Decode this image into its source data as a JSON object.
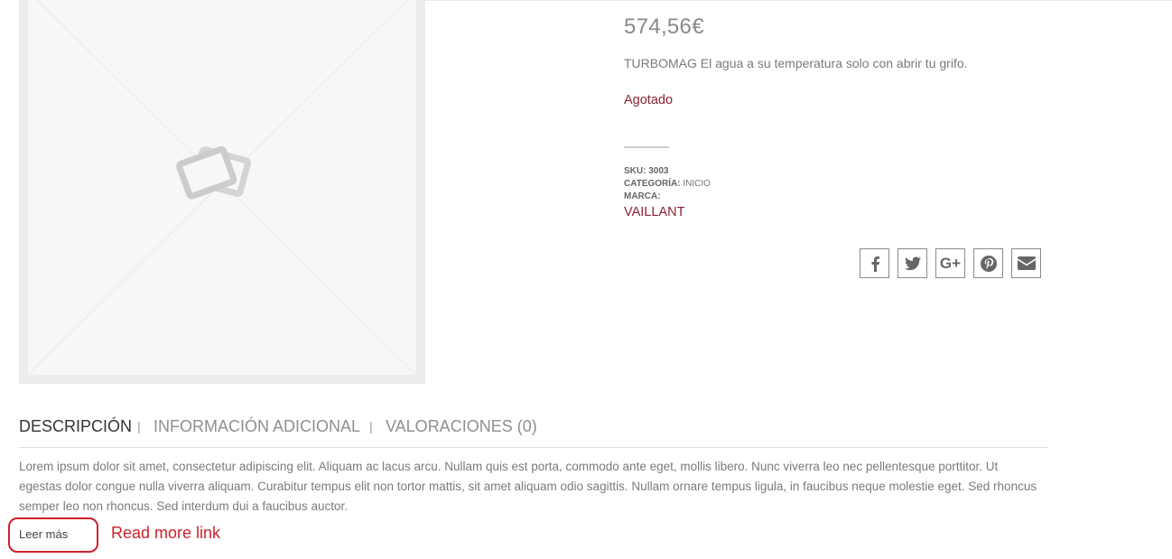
{
  "product": {
    "price": "574,56€",
    "short_description": "TURBOMAG El agua a su temperatura solo con abrir tu grifo.",
    "stock_status": "Agotado",
    "meta": {
      "sku_label": "SKU:",
      "sku_value": "3003",
      "category_label": "CATEGORÍA:",
      "category_value": "INICIO",
      "brand_label": "MARCA:",
      "brand_value": "VAILLANT"
    },
    "image_icon": "image-placeholder-icon"
  },
  "share": {
    "buttons": [
      {
        "name": "facebook",
        "icon": "facebook-icon"
      },
      {
        "name": "twitter",
        "icon": "twitter-icon"
      },
      {
        "name": "google-plus",
        "icon": "google-plus-icon",
        "text": "G+"
      },
      {
        "name": "pinterest",
        "icon": "pinterest-icon"
      },
      {
        "name": "email",
        "icon": "envelope-icon"
      }
    ]
  },
  "tabs": {
    "description": "DESCRIPCIÓN",
    "additional_info": "INFORMACIÓN ADICIONAL",
    "reviews": "VALORACIONES (0)",
    "separator": "|",
    "active": "description"
  },
  "description": {
    "text": "Lorem ipsum dolor sit amet, consectetur adipiscing elit. Aliquam ac lacus arcu. Nullam quis est porta, commodo ante eget, mollis libero. Nunc viverra leo nec pellentesque porttitor. Ut egestas dolor congue nulla viverra aliquam. Curabitur tempus elit non tortor mattis, sit amet aliquam odio sagittis. Nullam ornare tempus ligula, in faucibus neque molestie eget. Sed rhoncus semper leo non rhoncus. Sed interdum dui a faucibus auctor.",
    "read_more": "Leer más"
  },
  "annotation": {
    "label": "Read more link",
    "color": "#d0202a"
  },
  "colors": {
    "accent": "#8b2331",
    "text": "#777777"
  }
}
